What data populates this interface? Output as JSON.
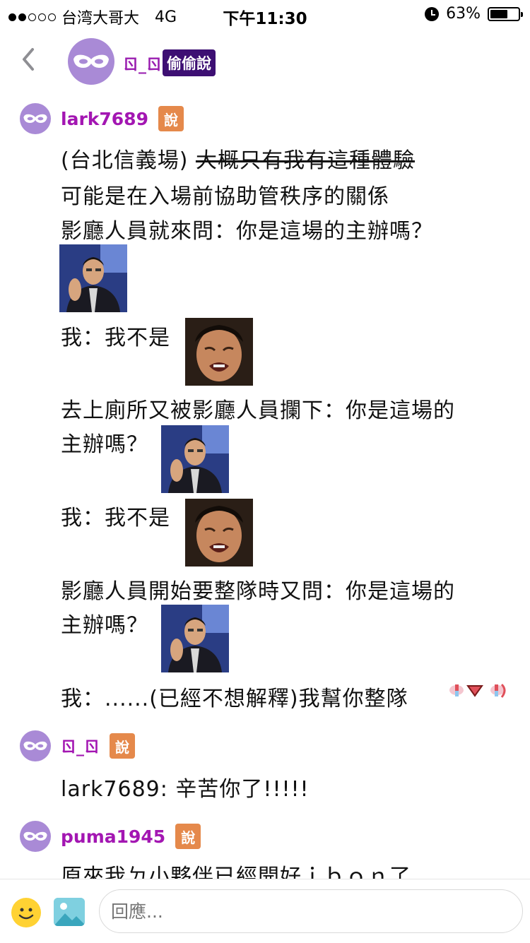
{
  "status_bar": {
    "carrier": "台湾大哥大",
    "network": "4G",
    "time": "下午11:30",
    "battery": "63%",
    "battery_level": 0.63
  },
  "header": {
    "nickname": "ㄖ_ㄖ",
    "badge": "偷偷說"
  },
  "posts": [
    {
      "username": "lark7689",
      "badge": "說",
      "lines": [
        {
          "a": "(台北信義場) ",
          "b": "大概只有我有這種體驗"
        },
        "可能是在入場前協助管秩序的關係",
        "影廳人員就來問：你是這場的主辦嗎？",
        "我：我不是",
        "去上廁所又被影廳人員攔下：你是這場的",
        "主辦嗎？",
        "我：我不是",
        "影廳人員開始要整隊時又問：你是這場的",
        "主辦嗎？",
        "我：......(已經不想解釋)我幫你整隊"
      ]
    },
    {
      "username": "ㄖ_ㄖ",
      "badge": "說",
      "text": "lark7689: 辛苦你了!!!!!"
    },
    {
      "username": "puma1945",
      "badge": "說",
      "text": "原來我ㄉ小夥伴已經開好ｉｂｏｎ了"
    }
  ],
  "composer": {
    "placeholder": "回應..."
  },
  "colors": {
    "username": "#a316b2",
    "say_badge": "#e5894b",
    "header_badge": "#3d0f73",
    "avatar": "#a98ad6"
  },
  "icons": [
    "back-chevron-icon",
    "mask-icon",
    "emoji-icon",
    "image-icon",
    "alarm-icon",
    "battery-icon"
  ]
}
